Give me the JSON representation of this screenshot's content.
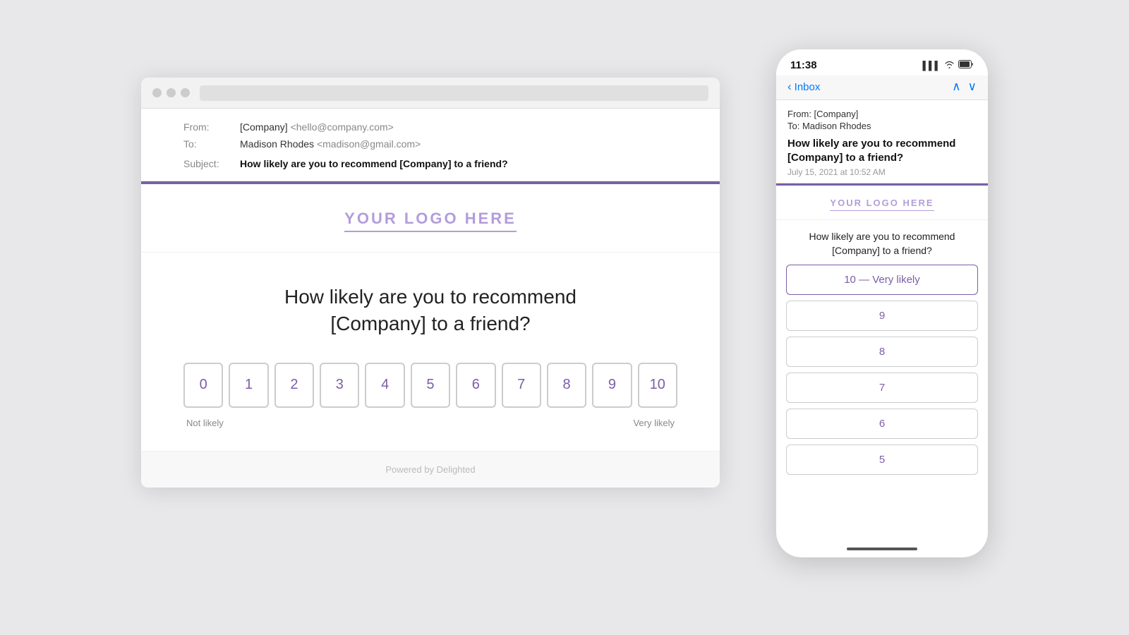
{
  "desktop": {
    "titlebar": {
      "tl1_color": "#ff5f57",
      "tl2_color": "#febc2e",
      "tl3_color": "#28c840"
    },
    "email": {
      "from_label": "From:",
      "from_name": "[Company]",
      "from_addr": "<hello@company.com>",
      "to_label": "To:",
      "to_name": "Madison Rhodes",
      "to_addr": "<madison@gmail.com>",
      "subject_label": "Subject:",
      "subject_text": "How likely are you to recommend [Company] to a friend?"
    },
    "logo": "YOUR LOGO HERE",
    "question": "How likely are you to recommend [Company] to a friend?",
    "nps_scores": [
      "0",
      "1",
      "2",
      "3",
      "4",
      "5",
      "6",
      "7",
      "8",
      "9",
      "10"
    ],
    "label_low": "Not likely",
    "label_high": "Very likely",
    "footer": "Powered by Delighted"
  },
  "mobile": {
    "time": "11:38",
    "signal_icon": "▌▌▌",
    "wifi_icon": "wifi",
    "battery_icon": "🔋",
    "back_label": "Inbox",
    "from_label": "From: [Company]",
    "to_label": "To: Madison Rhodes",
    "subject": "How likely are you to recommend [Company] to a friend?",
    "date": "July 15, 2021 at 10:52 AM",
    "logo": "YOUR LOGO HERE",
    "question": "How likely are you to recommend [Company] to a friend?",
    "options": [
      {
        "label": "10 — Very likely",
        "highlighted": true
      },
      {
        "label": "9",
        "highlighted": false
      },
      {
        "label": "8",
        "highlighted": false
      },
      {
        "label": "7",
        "highlighted": false
      },
      {
        "label": "6",
        "highlighted": false
      },
      {
        "label": "5",
        "highlighted": false
      }
    ]
  }
}
